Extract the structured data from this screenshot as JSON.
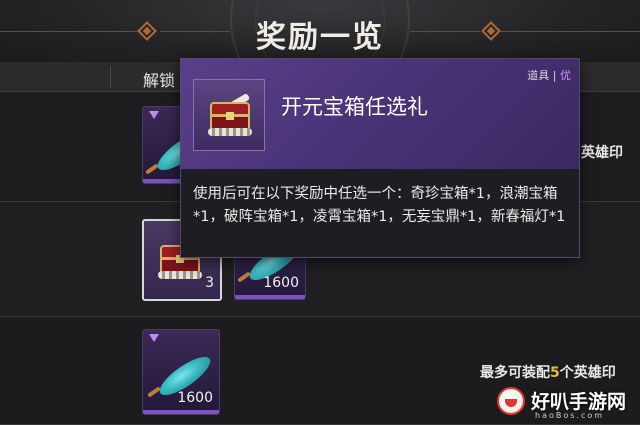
{
  "header": {
    "title": "奖励一览"
  },
  "columns": {
    "unlock_label": "解锁"
  },
  "rows": [
    {
      "items": [
        {
          "type": "feather",
          "qty": ""
        }
      ],
      "right_prefix": "",
      "right_count": "",
      "right_suffix": "英雄印"
    },
    {
      "items": [
        {
          "type": "chest",
          "qty": "3"
        },
        {
          "type": "feather",
          "qty": "1600"
        }
      ]
    },
    {
      "items": [
        {
          "type": "feather",
          "qty": "1600"
        }
      ],
      "right_prefix": "最多可装配",
      "right_count": "5",
      "right_suffix": "个英雄印"
    }
  ],
  "tooltip": {
    "name": "开元宝箱任选礼",
    "category": "道具",
    "separator": "|",
    "quality": "优",
    "description": "使用后可在以下奖励中任选一个：奇珍宝箱*1，浪潮宝箱*1，破阵宝箱*1，凌霄宝箱*1，无妄宝鼎*1，新春福灯*1"
  },
  "watermark": {
    "text": "好叭手游网",
    "sub": "haoBos.com"
  },
  "colors": {
    "accent_purple": "#7b52c2",
    "highlight_gold": "#e9b93c",
    "tooltip_purple": "#4a3478"
  }
}
